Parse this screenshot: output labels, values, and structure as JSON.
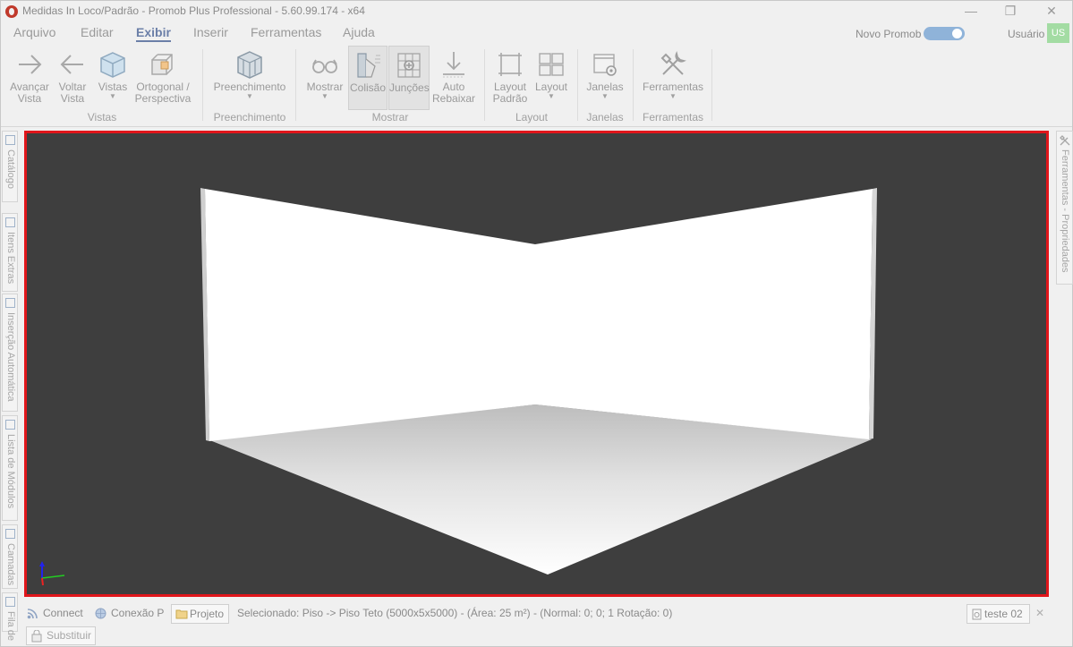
{
  "window": {
    "title": "Medidas In Loco/Padrão - Promob Plus Professional - 5.60.99.174 - x64",
    "controls": [
      "—",
      "❐",
      "✕"
    ]
  },
  "menu": {
    "items": [
      "Arquivo",
      "Editar",
      "Exibir",
      "Inserir",
      "Ferramentas",
      "Ajuda"
    ],
    "active": "Exibir"
  },
  "header_right": {
    "novo_promob": "Novo Promob",
    "toggle_on": true,
    "usuario": "Usuário",
    "avatar": "US"
  },
  "ribbon": {
    "groups": [
      {
        "label": "Vistas",
        "buttons": [
          {
            "l1": "Avançar",
            "l2": "Vista",
            "icon": "arrow-right-icon"
          },
          {
            "l1": "Voltar",
            "l2": "Vista",
            "icon": "arrow-left-icon"
          },
          {
            "l1": "Vistas",
            "l2": "",
            "icon": "cube-icon",
            "dropdown": true
          },
          {
            "l1": "Ortogonal /",
            "l2": "Perspectiva",
            "icon": "perspective-icon"
          }
        ]
      },
      {
        "label": "Preenchimento",
        "buttons": [
          {
            "l1": "Preenchimento",
            "l2": "",
            "icon": "fill-box-icon",
            "dropdown": true
          }
        ]
      },
      {
        "label": "Mostrar",
        "buttons": [
          {
            "l1": "Mostrar",
            "l2": "",
            "icon": "glasses-icon",
            "dropdown": true
          },
          {
            "l1": "Colisão",
            "l2": "",
            "icon": "collision-icon",
            "pressed": true
          },
          {
            "l1": "Junções",
            "l2": "",
            "icon": "joints-icon",
            "pressed": true
          },
          {
            "l1": "Auto",
            "l2": "Rebaixar",
            "icon": "lower-icon"
          }
        ]
      },
      {
        "label": "Layout",
        "buttons": [
          {
            "l1": "Layout",
            "l2": "Padrão",
            "icon": "layout-default-icon"
          },
          {
            "l1": "Layout",
            "l2": "",
            "icon": "layout-grid-icon",
            "dropdown": true
          }
        ]
      },
      {
        "label": "Janelas",
        "buttons": [
          {
            "l1": "Janelas",
            "l2": "",
            "icon": "window-gear-icon",
            "dropdown": true
          }
        ]
      },
      {
        "label": "Ferramentas",
        "buttons": [
          {
            "l1": "Ferramentas",
            "l2": "",
            "icon": "tools-icon",
            "dropdown": true
          }
        ]
      }
    ]
  },
  "left_tabs": [
    "Catálogo",
    "Itens Extras",
    "Inserção Automática",
    "Lista de Módulos",
    "Camadas",
    "Fila de"
  ],
  "right_tab": "Ferramentas - Propriedades",
  "statusbar": {
    "connect": "Connect",
    "conexao": "Conexão P",
    "projeto": "Projeto",
    "selection": "Selecionado: Piso -> Piso Teto (5000x5x5000) - (Área: 25 m²) - (Normal: 0; 0; 1 Rotação: 0)",
    "teste": "teste 02",
    "close": "✕"
  },
  "bottombar": {
    "substituir": "Substituir"
  },
  "colors": {
    "viewport_bg": "#3e3e3e",
    "viewport_border": "#e0161b",
    "accent": "#6b7fa8"
  }
}
